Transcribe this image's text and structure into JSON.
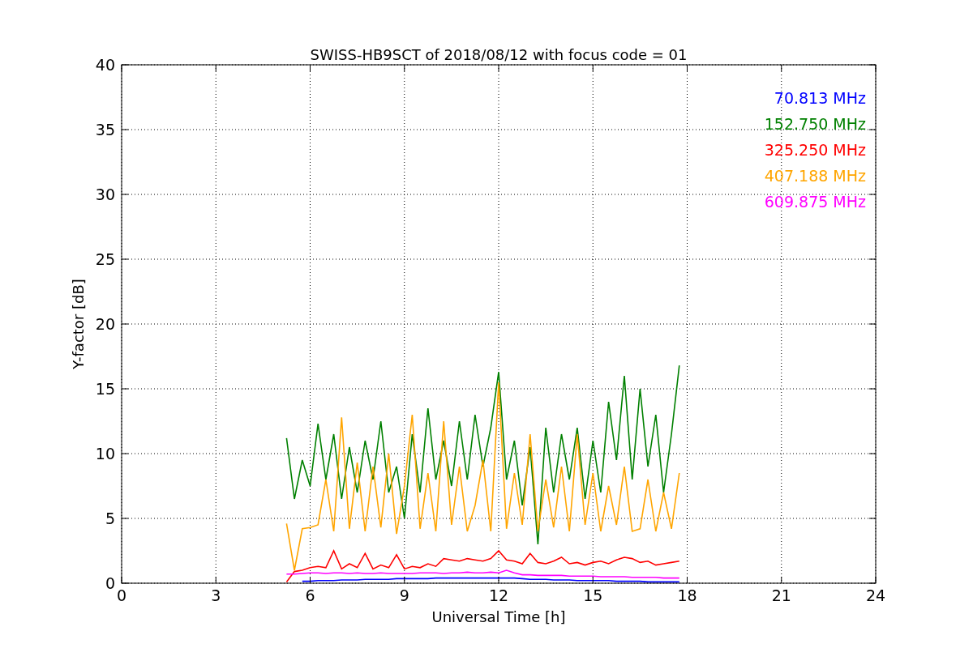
{
  "plot": {
    "chart_data": {
      "type": "line",
      "title": "SWISS-HB9SCT of 2018/08/12 with focus code = 01",
      "xlabel": "Universal Time [h]",
      "ylabel": "Y-factor [dB]",
      "x": [
        5.25,
        5.5,
        5.75,
        6,
        6.25,
        6.5,
        6.75,
        7,
        7.25,
        7.5,
        7.75,
        8,
        8.25,
        8.5,
        8.75,
        9,
        9.25,
        9.5,
        9.75,
        10,
        10.25,
        10.5,
        10.75,
        11,
        11.25,
        11.5,
        11.75,
        12,
        12.25,
        12.5,
        12.75,
        13,
        13.25,
        13.5,
        13.75,
        14,
        14.25,
        14.5,
        14.75,
        15,
        15.25,
        15.5,
        15.75,
        16,
        16.25,
        16.5,
        16.75,
        17,
        17.25,
        17.5,
        17.75
      ],
      "series": [
        {
          "name": "70.813 MHz",
          "color": "#0000ff",
          "values": [
            null,
            null,
            0.15,
            0.15,
            0.2,
            0.2,
            0.2,
            0.25,
            0.25,
            0.25,
            0.3,
            0.3,
            0.3,
            0.3,
            0.35,
            0.35,
            0.35,
            0.35,
            0.35,
            0.4,
            0.4,
            0.4,
            0.4,
            0.4,
            0.4,
            0.4,
            0.4,
            0.4,
            0.4,
            0.4,
            0.35,
            0.3,
            0.3,
            0.3,
            0.25,
            0.25,
            0.25,
            0.2,
            0.2,
            0.2,
            0.2,
            0.2,
            0.15,
            0.15,
            0.15,
            0.15,
            0.1,
            0.1,
            0.1,
            0.1,
            0.1
          ]
        },
        {
          "name": "152.750 MHz",
          "color": "#008000",
          "values": [
            11.2,
            6.5,
            9.5,
            7.5,
            12.3,
            8,
            11.5,
            6.5,
            10.5,
            7,
            11,
            8,
            12.5,
            7,
            9,
            5,
            11.5,
            7,
            13.5,
            8,
            11,
            7.5,
            12.5,
            8,
            13,
            9,
            12,
            16.3,
            8,
            11,
            6,
            10.5,
            3,
            12,
            7,
            11.5,
            8,
            12,
            6.5,
            11,
            7,
            14,
            9.5,
            16,
            8,
            15,
            9,
            13,
            7,
            11.5,
            16.8
          ]
        },
        {
          "name": "325.250 MHz",
          "color": "#ff0000",
          "values": [
            0.1,
            0.9,
            1,
            1.2,
            1.3,
            1.2,
            2.5,
            1.1,
            1.5,
            1.2,
            2.3,
            1.1,
            1.4,
            1.2,
            2.2,
            1.1,
            1.3,
            1.2,
            1.5,
            1.3,
            1.9,
            1.8,
            1.7,
            1.9,
            1.8,
            1.7,
            1.9,
            2.5,
            1.8,
            1.7,
            1.5,
            2.3,
            1.6,
            1.5,
            1.7,
            2,
            1.5,
            1.6,
            1.4,
            1.6,
            1.7,
            1.5,
            1.8,
            2,
            1.9,
            1.6,
            1.7,
            1.4,
            1.5,
            1.6,
            1.7
          ]
        },
        {
          "name": "407.188 MHz",
          "color": "#ffa500",
          "values": [
            4.6,
            1,
            4.2,
            4.3,
            4.5,
            8,
            4,
            12.8,
            4.2,
            9.3,
            4,
            9,
            4.3,
            10,
            3.8,
            7.5,
            13,
            4.2,
            8.5,
            4,
            12.5,
            4.5,
            9,
            4,
            6,
            9.5,
            4,
            15.5,
            4.2,
            8.5,
            4.5,
            11.5,
            4,
            8,
            4.3,
            9,
            4,
            11.5,
            4.5,
            8.5,
            4,
            7.5,
            4.5,
            9,
            4,
            4.2,
            8,
            4,
            7,
            4.2,
            8.5
          ]
        },
        {
          "name": "609.875 MHz",
          "color": "#ff00ff",
          "values": [
            0.7,
            0.7,
            0.75,
            0.8,
            0.8,
            0.75,
            0.8,
            0.8,
            0.75,
            0.8,
            0.75,
            0.75,
            0.8,
            0.75,
            0.75,
            0.75,
            0.75,
            0.8,
            0.8,
            0.8,
            0.75,
            0.8,
            0.8,
            0.85,
            0.8,
            0.8,
            0.85,
            0.8,
            1.0,
            0.8,
            0.65,
            0.65,
            0.6,
            0.6,
            0.6,
            0.6,
            0.55,
            0.55,
            0.55,
            0.55,
            0.5,
            0.5,
            0.5,
            0.5,
            0.45,
            0.45,
            0.45,
            0.45,
            0.4,
            0.4,
            0.4
          ]
        }
      ],
      "grid": true,
      "xlim": [
        0,
        24
      ],
      "ylim": [
        0,
        40
      ],
      "xticks": [
        0,
        3,
        6,
        9,
        12,
        15,
        18,
        21,
        24
      ],
      "yticks": [
        0,
        5,
        10,
        15,
        20,
        25,
        30,
        35,
        40
      ]
    }
  }
}
